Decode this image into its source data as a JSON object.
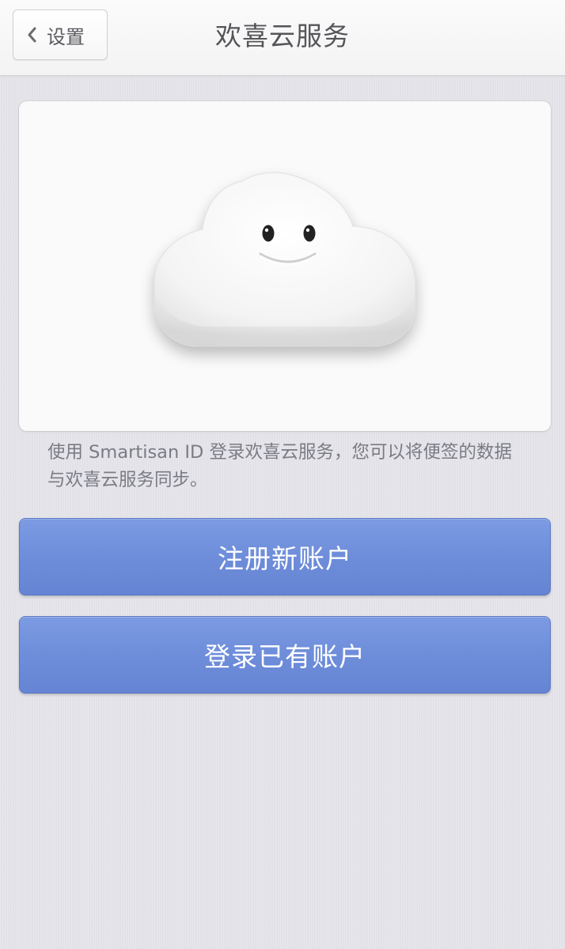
{
  "nav": {
    "back_label": "设置",
    "back_icon": "chevron-left-icon",
    "title": "欢喜云服务"
  },
  "hero": {
    "illustration": "smiling-cloud-icon"
  },
  "description": "使用 Smartisan ID 登录欢喜云服务，您可以将便签的数据与欢喜云服务同步。",
  "actions": {
    "register_label": "注册新账户",
    "login_label": "登录已有账户"
  },
  "colors": {
    "button_blue": "#6f8edb",
    "background": "#e4e4ea",
    "text_gray": "#7b7b84"
  }
}
